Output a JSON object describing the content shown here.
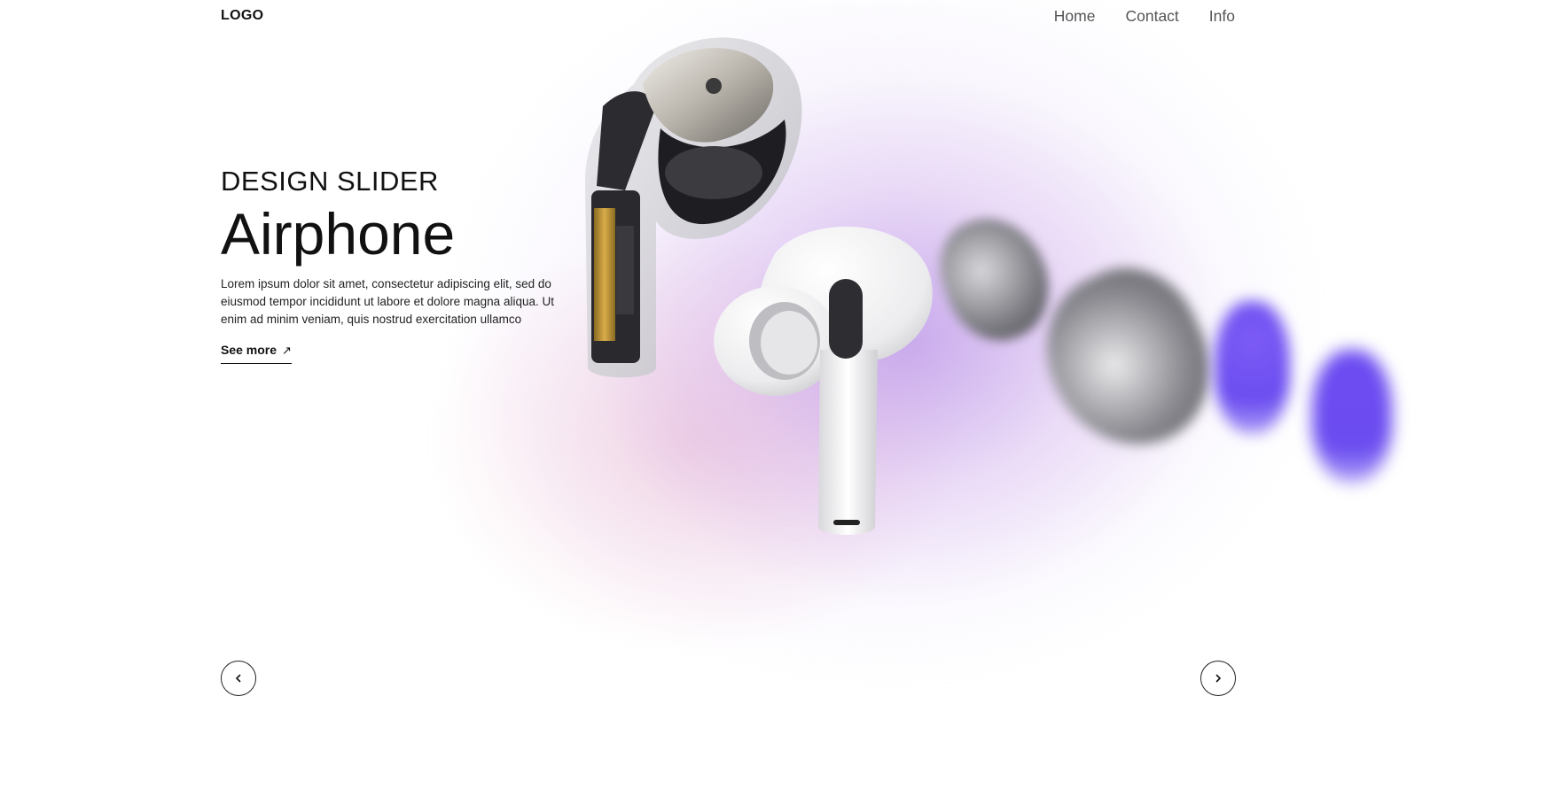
{
  "nav": {
    "logo": "LOGO",
    "links": [
      "Home",
      "Contact",
      "Info"
    ]
  },
  "hero": {
    "subtitle": "DESIGN SLIDER",
    "title": "Airphone",
    "description": "Lorem ipsum dolor sit amet, consectetur adipiscing elit, sed do eiusmod tempor incididunt ut labore et dolore magna aliqua. Ut enim ad minim veniam, quis nostrud exercitation ullamco",
    "cta": "See more",
    "cta_icon": "↗"
  },
  "slider": {
    "prev_icon": "chevron-left-icon",
    "next_icon": "chevron-right-icon"
  },
  "colors": {
    "accent_purple": "#6a4cf0",
    "glow_pink": "#e6aac8",
    "text_dark": "#111111",
    "nav_text": "#555555"
  }
}
